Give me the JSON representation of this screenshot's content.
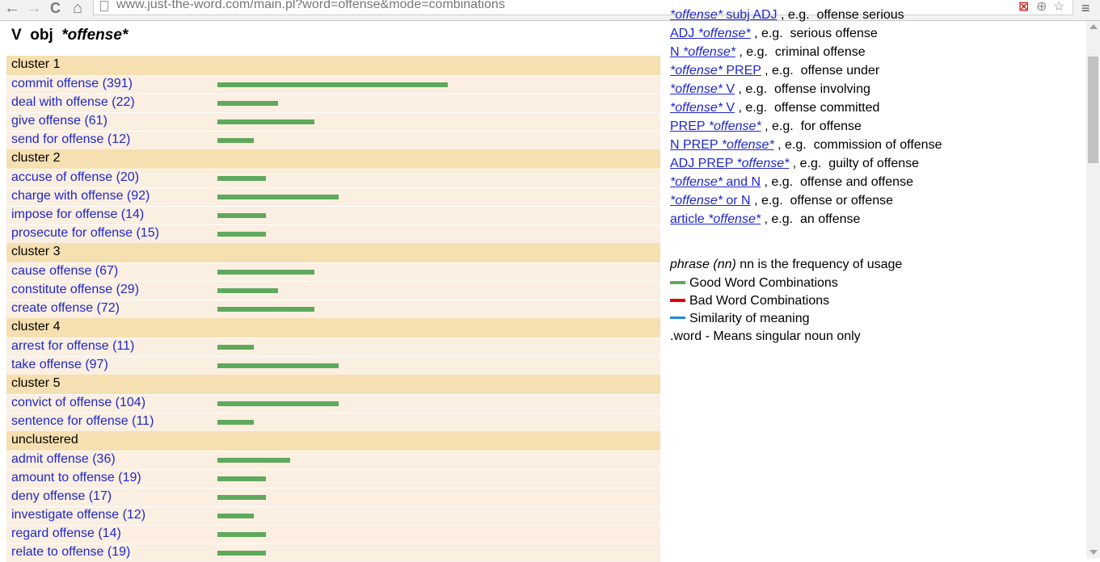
{
  "browser": {
    "url": "www.just-the-word.com/main.pl?word=offense&mode=combinations",
    "back_icon": "←",
    "forward_icon": "→",
    "reload_icon": "C",
    "home_icon": "⌂",
    "menu_icon": "≡"
  },
  "heading": {
    "prefix": "V  obj  ",
    "word": "*offense*"
  },
  "clusters": [
    {
      "label": "cluster 1",
      "items": [
        {
          "text": "commit offense (391)",
          "value": 391
        },
        {
          "text": "deal with offense (22)",
          "value": 22
        },
        {
          "text": "give offense (61)",
          "value": 61
        },
        {
          "text": "send for offense (12)",
          "value": 12
        }
      ]
    },
    {
      "label": "cluster 2",
      "items": [
        {
          "text": "accuse of offense (20)",
          "value": 20
        },
        {
          "text": "charge with offense (92)",
          "value": 92
        },
        {
          "text": "impose for offense (14)",
          "value": 14
        },
        {
          "text": "prosecute for offense (15)",
          "value": 15
        }
      ]
    },
    {
      "label": "cluster 3",
      "items": [
        {
          "text": "cause offense (67)",
          "value": 67
        },
        {
          "text": "constitute offense (29)",
          "value": 29
        },
        {
          "text": "create offense (72)",
          "value": 72
        }
      ]
    },
    {
      "label": "cluster 4",
      "items": [
        {
          "text": "arrest for offense (11)",
          "value": 11
        },
        {
          "text": "take offense (97)",
          "value": 97
        }
      ]
    },
    {
      "label": "cluster 5",
      "items": [
        {
          "text": "convict of offense (104)",
          "value": 104
        },
        {
          "text": "sentence for offense (11)",
          "value": 11
        }
      ]
    },
    {
      "label": "unclustered",
      "items": [
        {
          "text": "admit offense (36)",
          "value": 36
        },
        {
          "text": "amount to offense (19)",
          "value": 19
        },
        {
          "text": "deny offense (17)",
          "value": 17
        },
        {
          "text": "investigate offense (12)",
          "value": 12
        },
        {
          "text": "regard offense (14)",
          "value": 14
        },
        {
          "text": "relate to offense (19)",
          "value": 19
        }
      ]
    }
  ],
  "patterns": [
    {
      "pre": "",
      "word": "*offense*",
      "post": " subj ADJ",
      "example": " , e.g.  offense serious"
    },
    {
      "pre": "ADJ ",
      "word": "*offense*",
      "post": "",
      "example": " , e.g.  serious offense"
    },
    {
      "pre": "N ",
      "word": "*offense*",
      "post": "",
      "example": " , e.g.  criminal offense"
    },
    {
      "pre": "",
      "word": "*offense*",
      "post": " PREP",
      "example": " , e.g.  offense under"
    },
    {
      "pre": "",
      "word": "*offense*",
      "post": " V",
      "example": " , e.g.  offense involving"
    },
    {
      "pre": "",
      "word": "*offense*",
      "post": " V",
      "example": " , e.g.  offense committed"
    },
    {
      "pre": "PREP ",
      "word": "*offense*",
      "post": "",
      "example": " , e.g.  for offense"
    },
    {
      "pre": "N PREP ",
      "word": "*offense*",
      "post": "",
      "example": " , e.g.  commission of offense"
    },
    {
      "pre": "ADJ PREP ",
      "word": "*offense*",
      "post": "",
      "example": " , e.g.  guilty of offense"
    },
    {
      "pre": "",
      "word": "*offense*",
      "post": " and N",
      "example": " , e.g.  offense and offense"
    },
    {
      "pre": "",
      "word": "*offense*",
      "post": " or N",
      "example": " , e.g.  offense or offense"
    },
    {
      "pre": "article ",
      "word": "*offense*",
      "post": "",
      "example": " , e.g.  an offense"
    }
  ],
  "legend": {
    "phrase_italic": "phrase (nn)",
    "phrase_rest": " nn is the frequency of usage",
    "good": "Good Word Combinations",
    "bad": "Bad Word Combinations",
    "similar": "Similarity of meaning",
    "singular": ".word - Means singular noun only",
    "colors": {
      "good": "#5fa95c",
      "bad": "#e00000",
      "similar": "#1e88e5"
    }
  }
}
